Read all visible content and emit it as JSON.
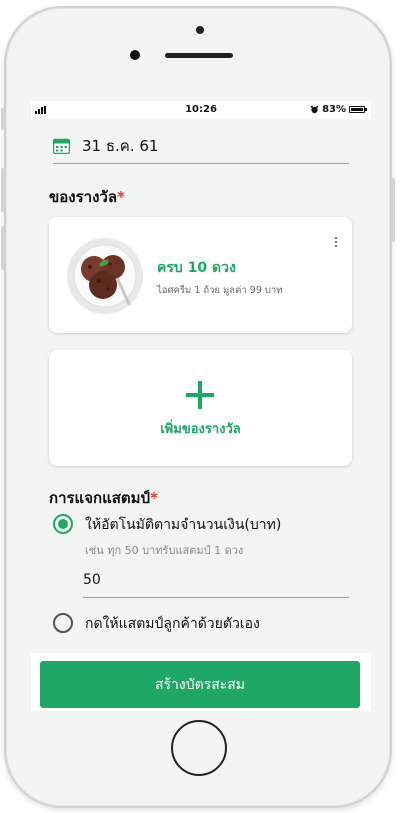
{
  "status_bar": {
    "time": "10:26",
    "battery": "83%"
  },
  "date": {
    "value": "31 ธ.ค. 61"
  },
  "reward_section": {
    "label": "ของรางวัล",
    "required_mark": "*",
    "item": {
      "title": "ครบ 10 ดวง",
      "subtitle": "ไอศครีม 1 ถ้วย มูลค่า 99 บาท",
      "image": "chocolate-ice-cream"
    },
    "add_label": "เพิ่มของรางวัล"
  },
  "stamp_section": {
    "label": "การแจกแสตมป์",
    "required_mark": "*",
    "option_auto": {
      "label": "ให้อัตโนมัติตามจำนวนเงิน(บาท)",
      "hint": "เช่น ทุก 50 บาทรับแสตมป์ 1 ดวง",
      "selected": true
    },
    "amount": "50",
    "option_manual": {
      "label": "กดให้แสตมป์ลูกค้าด้วยตัวเอง",
      "selected": false
    }
  },
  "submit": {
    "label": "สร้างบัตรสะสม"
  },
  "colors": {
    "accent": "#1fa865",
    "required": "#e53935"
  }
}
